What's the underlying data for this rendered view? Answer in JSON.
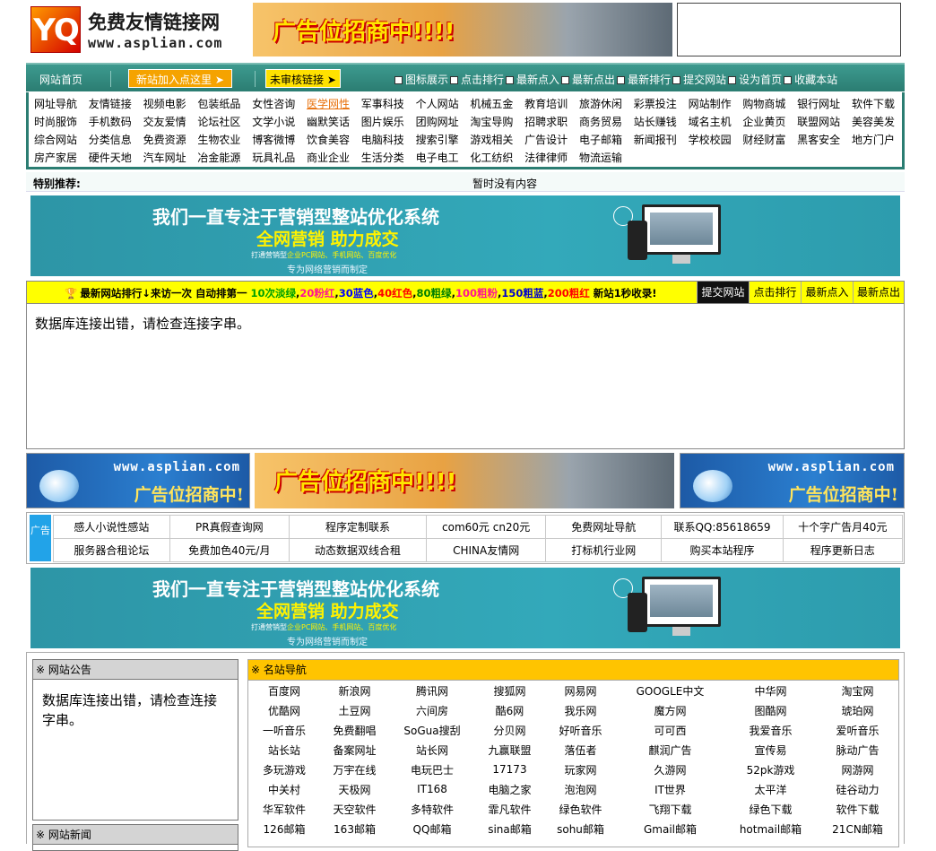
{
  "header": {
    "logo_mark": "YQ",
    "logo_title": "免费友情链接网",
    "logo_url": "www.asplian.com",
    "top_ad_text": "广告位招商中!!!!"
  },
  "nav": {
    "home": "网站首页",
    "join": "新站加入点这里",
    "pending": "未审核链接",
    "links": [
      "图标展示",
      "点击排行",
      "最新点入",
      "最新点出",
      "最新排行",
      "提交网站",
      "设为首页",
      "收藏本站"
    ]
  },
  "categories": [
    [
      "网址导航",
      "友情链接",
      "视频电影",
      "包装纸品",
      "女性咨询",
      "医学网性",
      "军事科技",
      "个人网站",
      "机械五金",
      "教育培训",
      "旅游休闲",
      "彩票投注",
      "网站制作",
      "购物商城",
      "银行网址",
      "软件下载"
    ],
    [
      "时尚服饰",
      "手机数码",
      "交友爱情",
      "论坛社区",
      "文学小说",
      "幽默笑话",
      "图片娱乐",
      "团购网址",
      "淘宝导购",
      "招聘求职",
      "商务贸易",
      "站长赚钱",
      "域名主机",
      "企业黄页",
      "联盟网站",
      "美容美发"
    ],
    [
      "综合网站",
      "分类信息",
      "免费资源",
      "生物农业",
      "博客微博",
      "饮食美容",
      "电脑科技",
      "搜索引擎",
      "游戏相关",
      "广告设计",
      "电子邮箱",
      "新闻报刊",
      "学校校园",
      "财经财富",
      "黑客安全",
      "地方门户"
    ],
    [
      "房产家居",
      "硬件天地",
      "汽车网址",
      "冶金能源",
      "玩具礼品",
      "商业企业",
      "生活分类",
      "电子电工",
      "化工纺织",
      "法律律师",
      "物流运输"
    ]
  ],
  "featured": {
    "label": "特别推荐:",
    "empty": "暂时没有内容"
  },
  "banner": {
    "line1": "我们一直专注于营销型整站优化系统",
    "line2": "全网营销 助力成交",
    "line3_prefix": "打通营销型",
    "line3_highlight": "企业PC网站、手机网站、百度优化",
    "line4": "专为网络营销而制定"
  },
  "rank": {
    "trophy": "🏆",
    "parts": [
      {
        "t": "最新网站排行↓来访一次 自动排第一 ",
        "c": "#000000"
      },
      {
        "t": "10次淡绿",
        "c": "#00a000"
      },
      {
        "t": ",",
        "c": "#000000"
      },
      {
        "t": "20粉红",
        "c": "#ff1493"
      },
      {
        "t": ",",
        "c": "#000000"
      },
      {
        "t": "30蓝色",
        "c": "#0000ff"
      },
      {
        "t": ",",
        "c": "#000000"
      },
      {
        "t": "40红色",
        "c": "#ff0000"
      },
      {
        "t": ",",
        "c": "#000000"
      },
      {
        "t": "80粗绿",
        "c": "#008000"
      },
      {
        "t": ",",
        "c": "#000000"
      },
      {
        "t": "100粗粉",
        "c": "#ff1493"
      },
      {
        "t": ",",
        "c": "#000000"
      },
      {
        "t": "150粗蓝",
        "c": "#0000cc"
      },
      {
        "t": ",",
        "c": "#000000"
      },
      {
        "t": "200粗红",
        "c": "#ff0000"
      },
      {
        "t": " 新站1秒收录!",
        "c": "#000000"
      }
    ],
    "buttons": [
      "提交网站",
      "点击排行",
      "最新点入",
      "最新点出"
    ]
  },
  "db_error": "数据库连接出错，请检查连接字串。",
  "mid_ads": {
    "side_url": "www.asplian.com",
    "side_text": "广告位招商中!",
    "center_text": "广告位招商中!!!!"
  },
  "text_ads": {
    "tag": "广告",
    "rows": [
      [
        "感人小说性感站",
        "PR真假查询网",
        "程序定制联系",
        "com60元 cn20元",
        "免费网址导航",
        "联系QQ:85618659",
        "十个字广告月40元"
      ],
      [
        "服务器合租论坛",
        "免费加色40元/月",
        "动态数据双线合租",
        "CHINA友情网",
        "打标机行业网",
        "购买本站程序",
        "程序更新日志"
      ]
    ]
  },
  "notice": {
    "title": "※ 网站公告",
    "body": "数据库连接出错，请检查连接字串。"
  },
  "news": {
    "title": "※ 网站新闻"
  },
  "famous": {
    "title": "※ 名站导航",
    "rows": [
      [
        "百度网",
        "新浪网",
        "腾讯网",
        "搜狐网",
        "网易网",
        "GOOGLE中文",
        "中华网",
        "淘宝网"
      ],
      [
        "优酷网",
        "土豆网",
        "六间房",
        "酷6网",
        "我乐网",
        "魔方网",
        "图酷网",
        "琥珀网"
      ],
      [
        "一听音乐",
        "免费翻唱",
        "SoGua搜刮",
        "分贝网",
        "好听音乐",
        "可可西",
        "我爱音乐",
        "爱听音乐"
      ],
      [
        "站长站",
        "备案网址",
        "站长网",
        "九赢联盟",
        "落伍者",
        "麒润广告",
        "宣传易",
        "脉动广告"
      ],
      [
        "多玩游戏",
        "万宇在线",
        "电玩巴士",
        "17173",
        "玩家网",
        "久游网",
        "52pk游戏",
        "网游网"
      ],
      [
        "中关村",
        "天极网",
        "IT168",
        "电脑之家",
        "泡泡网",
        "IT世界",
        "太平洋",
        "硅谷动力"
      ],
      [
        "华军软件",
        "天空软件",
        "多特软件",
        "霏凡软件",
        "绿色软件",
        "飞翔下载",
        "绿色下载",
        "软件下载"
      ],
      [
        "126邮箱",
        "163邮箱",
        "QQ邮箱",
        "sina邮箱",
        "sohu邮箱",
        "Gmail邮箱",
        "hotmail邮箱",
        "21CN邮箱"
      ]
    ]
  }
}
